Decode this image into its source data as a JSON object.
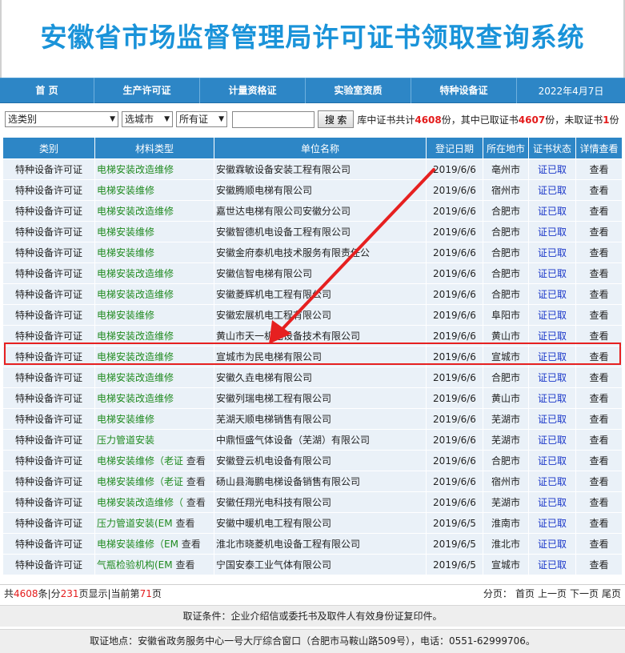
{
  "title": "安徽省市场监督管理局许可证书领取查询系统",
  "nav": {
    "items": [
      "首 页",
      "生产许可证",
      "计量资格证",
      "实验室资质",
      "特种设备证"
    ],
    "date": "2022年4月7日"
  },
  "search": {
    "category": "选类别",
    "city": "选城市",
    "cert": "所有证",
    "keyword": "",
    "button": "搜 索",
    "stat_prefix": "库中证书共计",
    "total": "4608",
    "stat_mid1": "份，其中已取证书",
    "taken": "4607",
    "stat_mid2": "份，未取证书",
    "untaken": "1",
    "stat_suffix": "份"
  },
  "table": {
    "headers": [
      "类别",
      "材料类型",
      "单位名称",
      "登记日期",
      "所在地市",
      "证书状态",
      "详情查看"
    ],
    "rows": [
      {
        "cat": "特种设备许可证",
        "mat": "电梯安装改造维修",
        "extra": "",
        "unit": "安徽霖敏设备安装工程有限公司",
        "date": "2019/6/6",
        "city": "亳州市",
        "status": "证已取",
        "view": "查看"
      },
      {
        "cat": "特种设备许可证",
        "mat": "电梯安装维修",
        "extra": "",
        "unit": "安徽腾顺电梯有限公司",
        "date": "2019/6/6",
        "city": "宿州市",
        "status": "证已取",
        "view": "查看"
      },
      {
        "cat": "特种设备许可证",
        "mat": "电梯安装改造维修",
        "extra": "",
        "unit": "嘉世达电梯有限公司安徽分公司",
        "date": "2019/6/6",
        "city": "合肥市",
        "status": "证已取",
        "view": "查看"
      },
      {
        "cat": "特种设备许可证",
        "mat": "电梯安装维修",
        "extra": "",
        "unit": "安徽智德机电设备工程有限公司",
        "date": "2019/6/6",
        "city": "合肥市",
        "status": "证已取",
        "view": "查看"
      },
      {
        "cat": "特种设备许可证",
        "mat": "电梯安装维修",
        "extra": "",
        "unit": "安徽金府泰机电技术服务有限责任公",
        "date": "2019/6/6",
        "city": "合肥市",
        "status": "证已取",
        "view": "查看"
      },
      {
        "cat": "特种设备许可证",
        "mat": "电梯安装改造维修",
        "extra": "",
        "unit": "安徽信智电梯有限公司",
        "date": "2019/6/6",
        "city": "合肥市",
        "status": "证已取",
        "view": "查看"
      },
      {
        "cat": "特种设备许可证",
        "mat": "电梯安装改造维修",
        "extra": "",
        "unit": "安徽菱辉机电工程有限公司",
        "date": "2019/6/6",
        "city": "合肥市",
        "status": "证已取",
        "view": "查看"
      },
      {
        "cat": "特种设备许可证",
        "mat": "电梯安装维修",
        "extra": "",
        "unit": "安徽宏展机电工程有限公司",
        "date": "2019/6/6",
        "city": "阜阳市",
        "status": "证已取",
        "view": "查看"
      },
      {
        "cat": "特种设备许可证",
        "mat": "电梯安装改造维修",
        "extra": "",
        "unit": "黄山市天一机电设备技术有限公司",
        "date": "2019/6/6",
        "city": "黄山市",
        "status": "证已取",
        "view": "查看"
      },
      {
        "cat": "特种设备许可证",
        "mat": "电梯安装改造维修",
        "extra": "",
        "unit": "宣城市为民电梯有限公司",
        "date": "2019/6/6",
        "city": "宣城市",
        "status": "证已取",
        "view": "查看"
      },
      {
        "cat": "特种设备许可证",
        "mat": "电梯安装改造维修",
        "extra": "",
        "unit": "安徽久垚电梯有限公司",
        "date": "2019/6/6",
        "city": "合肥市",
        "status": "证已取",
        "view": "查看"
      },
      {
        "cat": "特种设备许可证",
        "mat": "电梯安装改造维修",
        "extra": "",
        "unit": "安徽列瑞电梯工程有限公司",
        "date": "2019/6/6",
        "city": "黄山市",
        "status": "证已取",
        "view": "查看"
      },
      {
        "cat": "特种设备许可证",
        "mat": "电梯安装维修",
        "extra": "",
        "unit": "芜湖天顺电梯销售有限公司",
        "date": "2019/6/6",
        "city": "芜湖市",
        "status": "证已取",
        "view": "查看"
      },
      {
        "cat": "特种设备许可证",
        "mat": "压力管道安装",
        "extra": "",
        "unit": "中鼎恒盛气体设备（芜湖）有限公司",
        "date": "2019/6/6",
        "city": "芜湖市",
        "status": "证已取",
        "view": "查看"
      },
      {
        "cat": "特种设备许可证",
        "mat": "电梯安装维修（老证",
        "extra": " 查看",
        "unit": "安徽登云机电设备有限公司",
        "date": "2019/6/6",
        "city": "合肥市",
        "status": "证已取",
        "view": "查看"
      },
      {
        "cat": "特种设备许可证",
        "mat": "电梯安装维修（老证",
        "extra": " 查看",
        "unit": "砀山县海鹏电梯设备销售有限公司",
        "date": "2019/6/6",
        "city": "宿州市",
        "status": "证已取",
        "view": "查看"
      },
      {
        "cat": "特种设备许可证",
        "mat": "电梯安装改造维修（",
        "extra": " 查看",
        "unit": "安徽任翔光电科技有限公司",
        "date": "2019/6/6",
        "city": "芜湖市",
        "status": "证已取",
        "view": "查看"
      },
      {
        "cat": "特种设备许可证",
        "mat": "压力管道安装(EM",
        "extra": " 查看",
        "unit": "安徽中暖机电工程有限公司",
        "date": "2019/6/5",
        "city": "淮南市",
        "status": "证已取",
        "view": "查看"
      },
      {
        "cat": "特种设备许可证",
        "mat": "电梯安装维修（EM",
        "extra": " 查看",
        "unit": "淮北市晓菱机电设备工程有限公司",
        "date": "2019/6/5",
        "city": "淮北市",
        "status": "证已取",
        "view": "查看"
      },
      {
        "cat": "特种设备许可证",
        "mat": "气瓶检验机构(EM",
        "extra": " 查看",
        "unit": "宁国安泰工业气体有限公司",
        "date": "2019/6/5",
        "city": "宣城市",
        "status": "证已取",
        "view": "查看"
      }
    ]
  },
  "pager": {
    "p1": "共",
    "total": "4608",
    "p2": "条|分",
    "pages": "231",
    "p3": "页显示|当前第",
    "current": "71",
    "p4": "页",
    "label": "分页：",
    "first": "首页",
    "prev": "上一页",
    "next": "下一页",
    "last": "尾页"
  },
  "footer": {
    "condition": "取证条件：企业介绍信或委托书及取件人有效身份证复印件。",
    "location": "取证地点：安徽省政务服务中心一号大厅综合窗口（合肥市马鞍山路509号），电话：0551-62999706。"
  },
  "colors": {
    "accent": "#2d86c6",
    "highlight": "#e62020",
    "title": "#1a93d9",
    "material": "#1f8a1f",
    "link": "#1a37c9"
  }
}
